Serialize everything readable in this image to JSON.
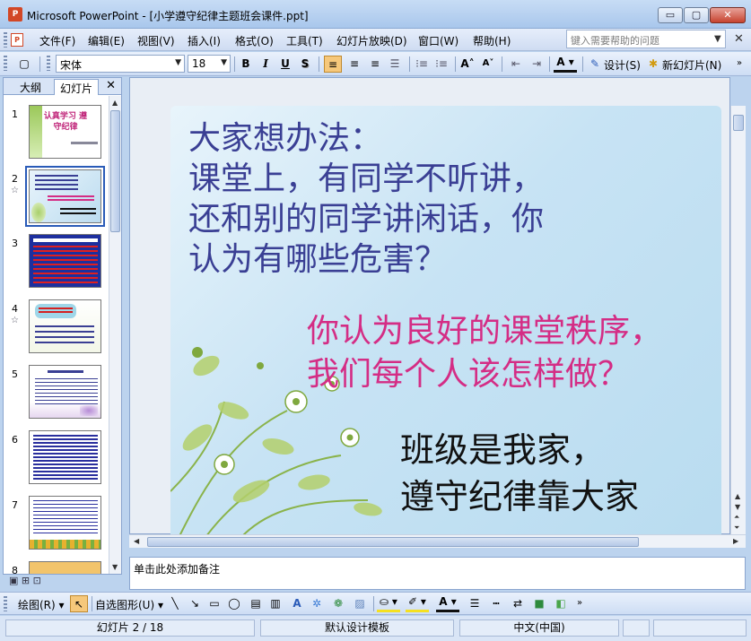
{
  "window": {
    "title": "Microsoft PowerPoint - [小学遵守纪律主题班会课件.ppt]",
    "app_icon_text": "P",
    "controls": {
      "minimize": "▭",
      "maximize": "▢",
      "close": "✕"
    }
  },
  "menubar": {
    "items": [
      "文件(F)",
      "编辑(E)",
      "视图(V)",
      "插入(I)",
      "格式(O)",
      "工具(T)",
      "幻灯片放映(D)",
      "窗口(W)",
      "帮助(H)"
    ],
    "help_placeholder": "键入需要帮助的问题"
  },
  "toolbar": {
    "font_name": "宋体",
    "font_size": "18",
    "bold": "B",
    "italic": "I",
    "underline": "U",
    "shadow": "S",
    "design_label": "设计(S)",
    "new_slide_label": "新幻灯片(N)"
  },
  "left_pane": {
    "tabs": [
      "大纲",
      "幻灯片"
    ],
    "active_tab": "幻灯片",
    "close": "✕",
    "thumbnails": [
      {
        "number": "1",
        "title": "认真学习 遵守纪律",
        "selected": false,
        "has_animation": false
      },
      {
        "number": "2",
        "selected": true,
        "has_animation": true
      },
      {
        "number": "3",
        "selected": false,
        "has_animation": false
      },
      {
        "number": "4",
        "selected": false,
        "has_animation": true
      },
      {
        "number": "5",
        "selected": false,
        "has_animation": false
      },
      {
        "number": "6",
        "selected": false,
        "has_animation": false
      },
      {
        "number": "7",
        "selected": false,
        "has_animation": false
      },
      {
        "number": "8",
        "selected": false,
        "has_animation": false
      }
    ]
  },
  "slide": {
    "question_lines": [
      "大家想办法：",
      "课堂上，有同学不听讲，",
      "还和别的同学讲闲话，你",
      "认为有哪些危害？"
    ],
    "pink_lines": [
      "你认为良好的课堂秩序，",
      "我们每个人该怎样做？"
    ],
    "black_lines": [
      "班级是我家，",
      "遵守纪律靠大家"
    ],
    "colors": {
      "question": "#3a3f94",
      "pink": "#d42d85",
      "black": "#111111"
    }
  },
  "notes": {
    "placeholder": "单击此处添加备注"
  },
  "drawbar": {
    "draw_label": "绘图(R)",
    "autoshape_label": "自选图形(U)"
  },
  "status": {
    "slide_info": "幻灯片 2 / 18",
    "template": "默认设计模板",
    "language": "中文(中国)"
  }
}
